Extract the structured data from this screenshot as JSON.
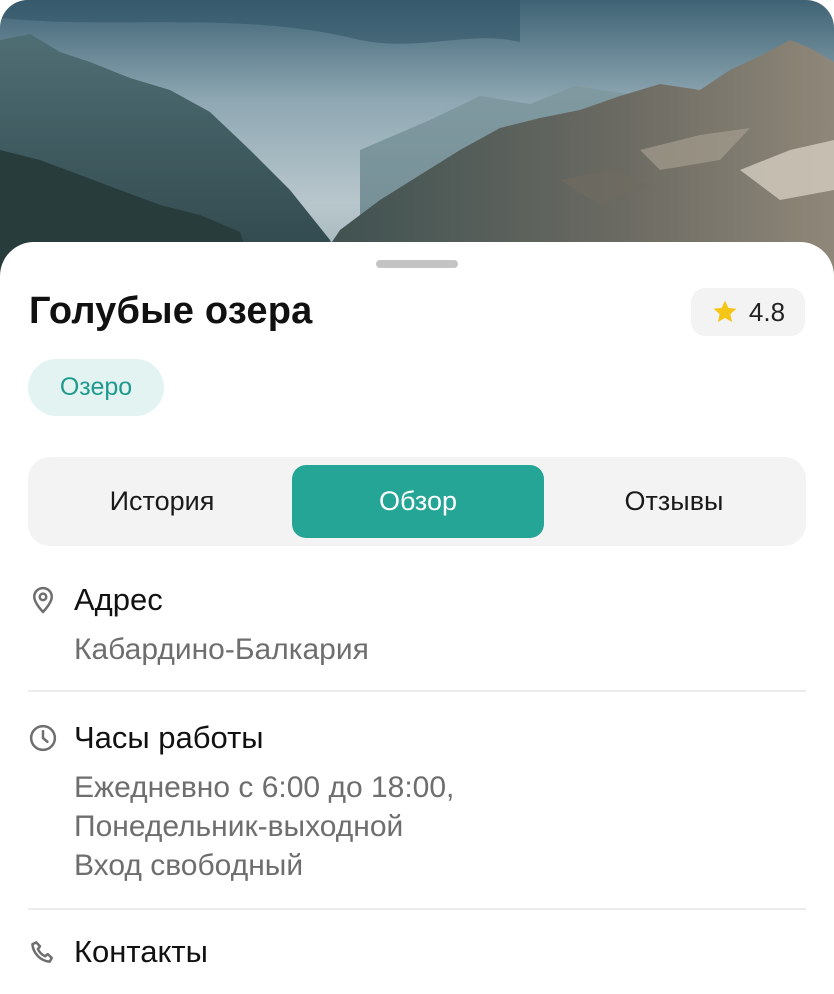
{
  "place": {
    "title": "Голубые озера",
    "rating": "4.8",
    "category": "Озеро"
  },
  "tabs": [
    {
      "label": "История",
      "active": false
    },
    {
      "label": "Обзор",
      "active": true
    },
    {
      "label": "Отзывы",
      "active": false
    }
  ],
  "sections": {
    "address": {
      "icon": "location-pin-icon",
      "title": "Адрес",
      "lines": [
        "Кабардино-Балкария"
      ]
    },
    "hours": {
      "icon": "clock-icon",
      "title": "Часы работы",
      "lines": [
        "Ежедневно с 6:00 до 18:00,",
        "Понедельник-выходной",
        "Вход свободный"
      ]
    },
    "contacts": {
      "icon": "phone-icon",
      "title": "Контакты"
    }
  },
  "colors": {
    "accent": "#25a595",
    "tag_bg": "#e3f3f1",
    "tag_text": "#1f9a8d",
    "star": "#f5c518"
  }
}
